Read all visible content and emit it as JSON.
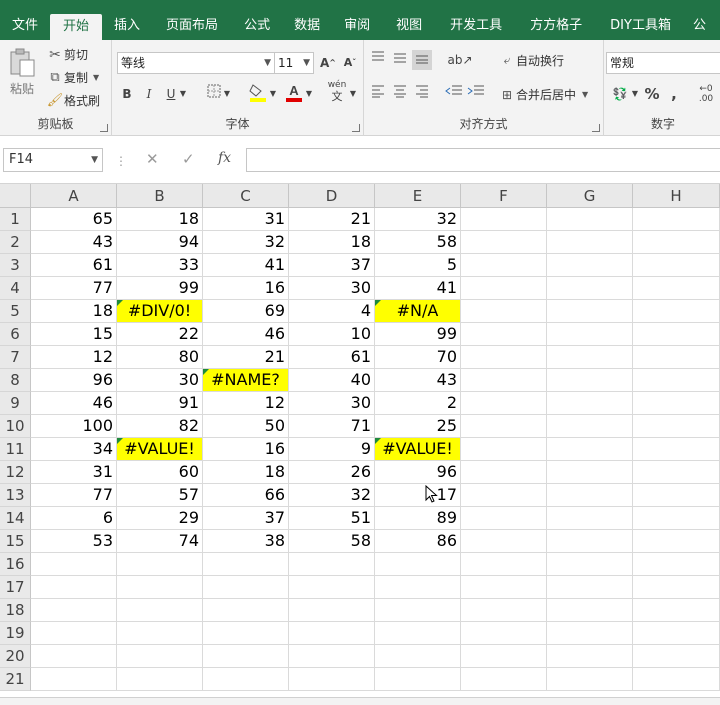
{
  "ribbon_tabs": [
    "文件",
    "开始",
    "插入",
    "页面布局",
    "公式",
    "数据",
    "审阅",
    "视图",
    "开发工具",
    "方方格子",
    "DIY工具箱",
    "公"
  ],
  "active_tab": "开始",
  "clipboard": {
    "paste": "粘贴",
    "cut": "剪切",
    "copy": "复制",
    "format_painter": "格式刷",
    "group_label": "剪贴板"
  },
  "font": {
    "font_name": "等线",
    "font_size": "11",
    "bold": "B",
    "italic": "I",
    "underline": "U",
    "phonetic": "wén",
    "group_label": "字体"
  },
  "alignment": {
    "wrap_text": "自动换行",
    "merge_center": "合并后居中",
    "group_label": "对齐方式"
  },
  "number": {
    "format": "常规",
    "percent": "%",
    "comma": ",",
    "group_label": "数字"
  },
  "formula_bar": {
    "name_box": "F14",
    "fx": "fx",
    "content": ""
  },
  "columns": [
    "A",
    "B",
    "C",
    "D",
    "E",
    "F",
    "G",
    "H"
  ],
  "rows": [
    "1",
    "2",
    "3",
    "4",
    "5",
    "6",
    "7",
    "8",
    "9",
    "10",
    "11",
    "12",
    "13",
    "14",
    "15",
    "16",
    "17",
    "18",
    "19",
    "20",
    "21"
  ],
  "cells": [
    [
      "65",
      "18",
      "31",
      "21",
      "32"
    ],
    [
      "43",
      "94",
      "32",
      "18",
      "58"
    ],
    [
      "61",
      "33",
      "41",
      "37",
      "5"
    ],
    [
      "77",
      "99",
      "16",
      "30",
      "41"
    ],
    [
      "18",
      "#DIV/0!",
      "69",
      "4",
      "#N/A"
    ],
    [
      "15",
      "22",
      "46",
      "10",
      "99"
    ],
    [
      "12",
      "80",
      "21",
      "61",
      "70"
    ],
    [
      "96",
      "30",
      "#NAME?",
      "40",
      "43"
    ],
    [
      "46",
      "91",
      "12",
      "30",
      "2"
    ],
    [
      "100",
      "82",
      "50",
      "71",
      "25"
    ],
    [
      "34",
      "#VALUE!",
      "16",
      "9",
      "#VALUE!"
    ],
    [
      "31",
      "60",
      "18",
      "26",
      "96"
    ],
    [
      "77",
      "57",
      "66",
      "32",
      "17"
    ],
    [
      "6",
      "29",
      "37",
      "51",
      "89"
    ],
    [
      "53",
      "74",
      "38",
      "58",
      "86"
    ]
  ],
  "colors": {
    "accent": "#217346",
    "error_fill": "#ffff00",
    "error_flag": "#1e8a3c"
  }
}
